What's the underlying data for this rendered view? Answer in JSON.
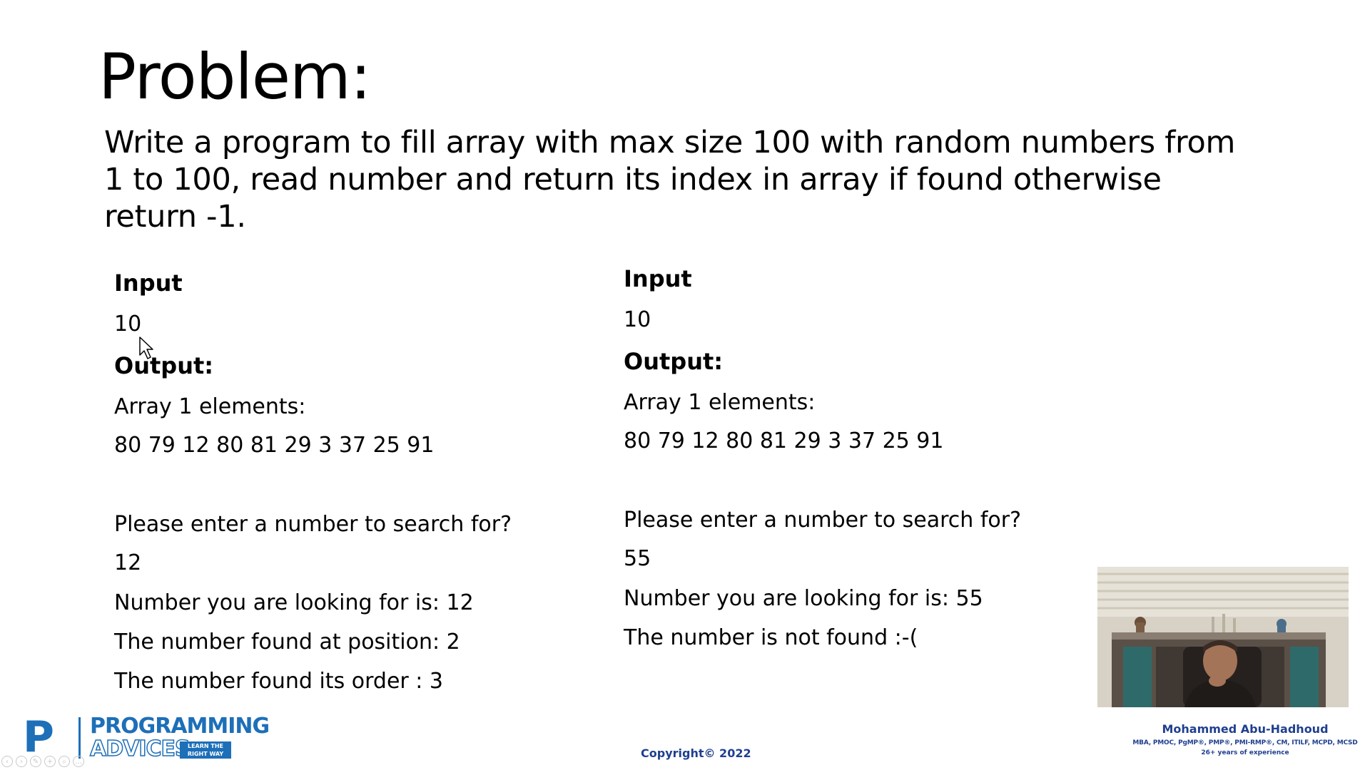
{
  "slide": {
    "title": "Problem:",
    "problem_lines": [
      "Write a program to fill array with max size 100 with random numbers from",
      "1 to 100, read number and return its index in array if found otherwise",
      "return -1."
    ]
  },
  "example_found": {
    "input_label": "Input",
    "input_value": "10",
    "output_label": "Output:",
    "array_label": "Array 1 elements:",
    "array_values": "80 79 12 80 81 29 3 37 25 91",
    "prompt": "Please enter a number to search for?",
    "search_value": "12",
    "looking_for": "Number you are looking for is: 12",
    "found_position": "The number found at position: 2",
    "found_order": "The number found its order  : 3"
  },
  "example_not_found": {
    "input_label": "Input",
    "input_value": "10",
    "output_label": "Output:",
    "array_label": "Array 1 elements:",
    "array_values": "80 79 12 80 81 29 3 37 25 91",
    "prompt": "Please enter a number to search for?",
    "search_value": "55",
    "looking_for": "Number you are looking for is: 55",
    "not_found": "The number is not found :-("
  },
  "branding": {
    "logo_line1": "PROGRAMMING",
    "logo_line2": "ADVICES",
    "logo_tagline_1": "LEARN THE",
    "logo_tagline_2": "RIGHT WAY",
    "copyright": "Copyright© 2022",
    "brand_color": "#1d6fb8",
    "text_accent_color": "#1f3f8f"
  },
  "presenter": {
    "name": "Mohammed Abu-Hadhoud",
    "credentials": "MBA, PMOC, PgMP®, PMP®, PMI-RMP®, CM, ITILF, MCPD, MCSD",
    "experience": "26+ years of experience"
  },
  "icons": {
    "cursor": "mouse-pointer-icon",
    "player_controls": [
      "back-icon",
      "forward-icon",
      "pen-icon",
      "zoom-icon",
      "search-icon",
      "more-icon"
    ]
  }
}
